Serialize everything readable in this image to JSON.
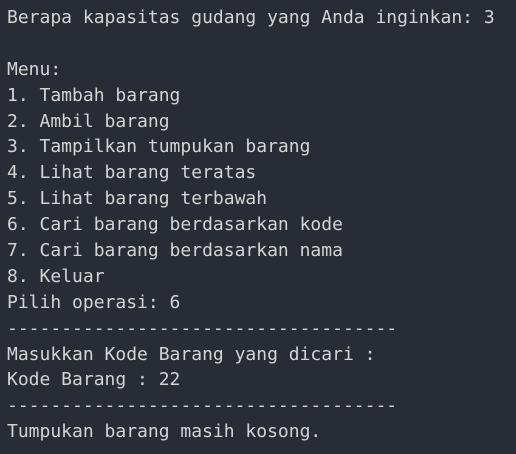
{
  "terminal": {
    "lines": [
      "Berapa kapasitas gudang yang Anda inginkan: 3",
      "",
      "Menu:",
      "1. Tambah barang",
      "2. Ambil barang",
      "3. Tampilkan tumpukan barang",
      "4. Lihat barang teratas",
      "5. Lihat barang terbawah",
      "6. Cari barang berdasarkan kode",
      "7. Cari barang berdasarkan nama",
      "8. Keluar",
      "Pilih operasi: 6",
      "------------------------------------",
      "Masukkan Kode Barang yang dicari :",
      "Kode Barang : 22",
      "------------------------------------",
      "Tumpukan barang masih kosong."
    ]
  }
}
